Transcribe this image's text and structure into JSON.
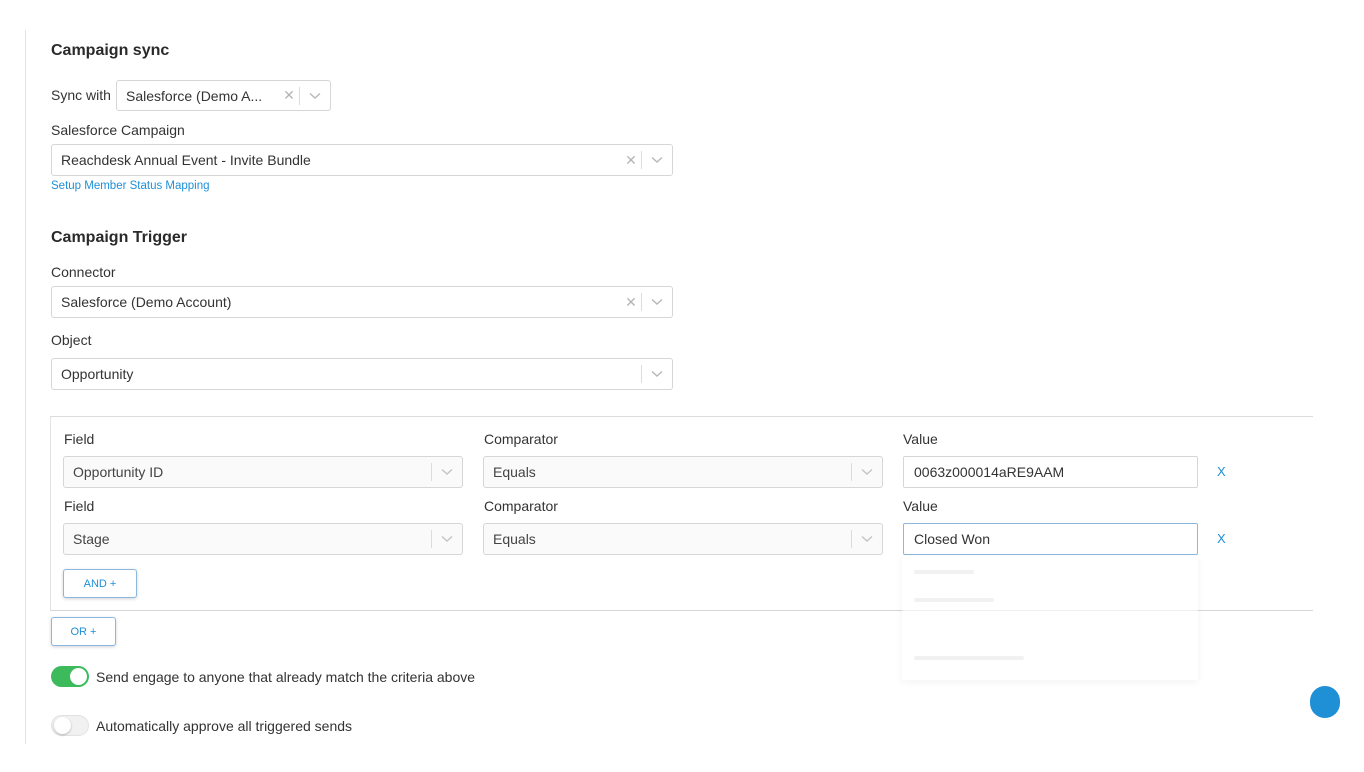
{
  "campaign_sync": {
    "title": "Campaign sync",
    "sync_with_label": "Sync with",
    "sync_with_value": "Salesforce (Demo A...",
    "salesforce_campaign_label": "Salesforce Campaign",
    "salesforce_campaign_value": "Reachdesk Annual Event - Invite Bundle",
    "setup_link": "Setup Member Status Mapping"
  },
  "campaign_trigger": {
    "title": "Campaign Trigger",
    "connector_label": "Connector",
    "connector_value": "Salesforce (Demo Account)",
    "object_label": "Object",
    "object_value": "Opportunity"
  },
  "conditions": [
    {
      "field_label": "Field",
      "field_value": "Opportunity ID",
      "comparator_label": "Comparator",
      "comparator_value": "Equals",
      "value_label": "Value",
      "value": "0063z000014aRE9AAM",
      "remove": "X"
    },
    {
      "field_label": "Field",
      "field_value": "Stage",
      "comparator_label": "Comparator",
      "comparator_value": "Equals",
      "value_label": "Value",
      "value": "Closed Won",
      "remove": "X"
    }
  ],
  "buttons": {
    "and": "AND +",
    "or": "OR +"
  },
  "toggles": [
    {
      "label": "Send engage to anyone that already match the criteria above",
      "on": true
    },
    {
      "label": "Automatically approve all triggered sends",
      "on": false
    }
  ],
  "colors": {
    "accent": "#1f8fd6",
    "toggle_on": "#3cba5c",
    "clear_icon": "#b5b5b5"
  },
  "icons": {
    "clear": "close-icon",
    "dropdown": "chevron-down-icon"
  }
}
